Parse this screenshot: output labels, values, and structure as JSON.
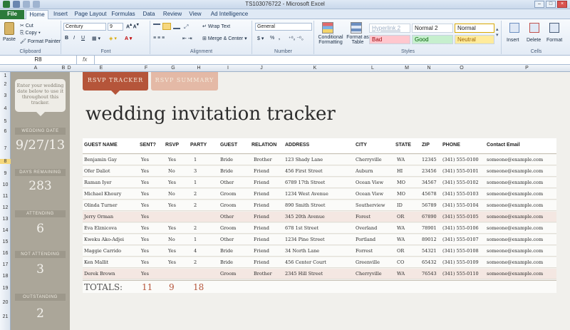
{
  "window": {
    "title": "TS103076722  -  Microsoft Excel"
  },
  "tabs": [
    "File",
    "Home",
    "Insert",
    "Page Layout",
    "Formulas",
    "Data",
    "Review",
    "View",
    "Ad Intelligence"
  ],
  "ribbon": {
    "clipboard": {
      "paste": "Paste",
      "cut": "Cut",
      "copy": "Copy",
      "format_painter": "Format Painter",
      "label": "Clipboard"
    },
    "font": {
      "name": "Century",
      "size": "9",
      "label": "Font"
    },
    "alignment": {
      "wrap_text": "Wrap Text",
      "merge_center": "Merge & Center",
      "label": "Alignment"
    },
    "number": {
      "format": "General",
      "currency": "$",
      "percent": "%",
      "comma": ",",
      "label": "Number"
    },
    "styles": {
      "conditional_formatting": "Conditional Formatting",
      "format_as_table": "Format as Table",
      "cell_styles": [
        "Hyperlink 2",
        "Normal 2",
        "Normal",
        "Bad",
        "Good",
        "Neutral"
      ],
      "label": "Styles"
    },
    "cells": {
      "insert": "Insert",
      "delete": "Delete",
      "format": "Format",
      "label": "Cells"
    }
  },
  "formula_bar": {
    "name_box": "R8",
    "fx": "fx",
    "value": ""
  },
  "columns": [
    "A",
    "B",
    "D",
    "E",
    "F",
    "G",
    "H",
    "I",
    "J",
    "K",
    "L",
    "M",
    "N",
    "O",
    "P"
  ],
  "rows": [
    "1",
    "2",
    "3",
    "4",
    "5",
    "6",
    "7",
    "8",
    "9",
    "10",
    "11",
    "12",
    "13",
    "14",
    "15",
    "16",
    "17",
    "18",
    "19",
    "20",
    "21"
  ],
  "sidebar": {
    "note": "Enter your wedding date below to use it throughout this tracker.",
    "wedding_date_label": "WEDDING DATE",
    "wedding_date": "9/27/13",
    "days_remaining_label": "DAYS REMAINING",
    "days_remaining": "283",
    "attending_label": "ATTENDING",
    "attending": "6",
    "not_attending_label": "NOT ATTENDING",
    "not_attending": "3",
    "outstanding_label": "OUTSTANDING",
    "outstanding": "2"
  },
  "sheet_tabs": {
    "rsvp_tracker": "RSVP TRACKER",
    "rsvp_summary": "RSVP SUMMARY"
  },
  "heading": "wedding invitation tracker",
  "table": {
    "headers": [
      "GUEST NAME",
      "SENT?",
      "RSVP",
      "PARTY",
      "GUEST",
      "RELATION",
      "ADDRESS",
      "CITY",
      "STATE",
      "ZIP",
      "PHONE",
      "Contact Email"
    ],
    "rows": [
      [
        "Benjamin Gay",
        "Yes",
        "Yes",
        "1",
        "Bride",
        "Brother",
        "123 Shady Lane",
        "Cherryville",
        "WA",
        "12345",
        "(341) 555-0100",
        "someone@example.com"
      ],
      [
        "Ofer Daliot",
        "Yes",
        "No",
        "3",
        "Bride",
        "Friend",
        "456 First Street",
        "Auburn",
        "HI",
        "23456",
        "(341) 555-0101",
        "someone@example.com"
      ],
      [
        "Raman Iyer",
        "Yes",
        "Yes",
        "1",
        "Other",
        "Friend",
        "6789 17th Street",
        "Ocean View",
        "MO",
        "34567",
        "(341) 555-0102",
        "someone@example.com"
      ],
      [
        "Michael Khoury",
        "Yes",
        "No",
        "2",
        "Groom",
        "Friend",
        "1234 West Avenue",
        "Ocean View",
        "MO",
        "45678",
        "(341) 555-0103",
        "someone@example.com"
      ],
      [
        "Olinda Turner",
        "Yes",
        "Yes",
        "2",
        "Groom",
        "Friend",
        "890 Smith Street",
        "Southerview",
        "ID",
        "56789",
        "(341) 555-0104",
        "someone@example.com"
      ],
      [
        "Jerry Orman",
        "Yes",
        "",
        "",
        "Other",
        "Friend",
        "345 20th Avenue",
        "Forest",
        "OR",
        "67890",
        "(341) 555-0105",
        "someone@example.com"
      ],
      [
        "Eva Elznicova",
        "Yes",
        "Yes",
        "2",
        "Groom",
        "Friend",
        "678 1st Street",
        "Overland",
        "WA",
        "78901",
        "(341) 555-0106",
        "someone@example.com"
      ],
      [
        "Kweku Ako-Adjei",
        "Yes",
        "No",
        "1",
        "Other",
        "Friend",
        "1234 Pine Street",
        "Portland",
        "WA",
        "89012",
        "(341) 555-0107",
        "someone@example.com"
      ],
      [
        "Maggie Carrido",
        "Yes",
        "Yes",
        "4",
        "Bride",
        "Friend",
        "34 North Lane",
        "Forrest",
        "OR",
        "54321",
        "(341) 555-0108",
        "someone@example.com"
      ],
      [
        "Ken Mallit",
        "Yes",
        "Yes",
        "2",
        "Bride",
        "Friend",
        "456 Center Court",
        "Greenville",
        "CO",
        "65432",
        "(341) 555-0109",
        "someone@example.com"
      ],
      [
        "Derek Brown",
        "Yes",
        "",
        "",
        "Groom",
        "Brother",
        "2345 Hill Street",
        "Cherryville",
        "WA",
        "76543",
        "(341) 555-0110",
        "someone@example.com"
      ]
    ],
    "pink_rows": [
      5,
      10
    ],
    "totals": {
      "label": "TOTALS:",
      "sent": "11",
      "rsvp": "9",
      "party": "18"
    }
  },
  "colors": {
    "accent": "#b5553a",
    "accent_light": "#e4b9a6",
    "sidebar": "#aba699",
    "total_text": "#b5553a"
  }
}
